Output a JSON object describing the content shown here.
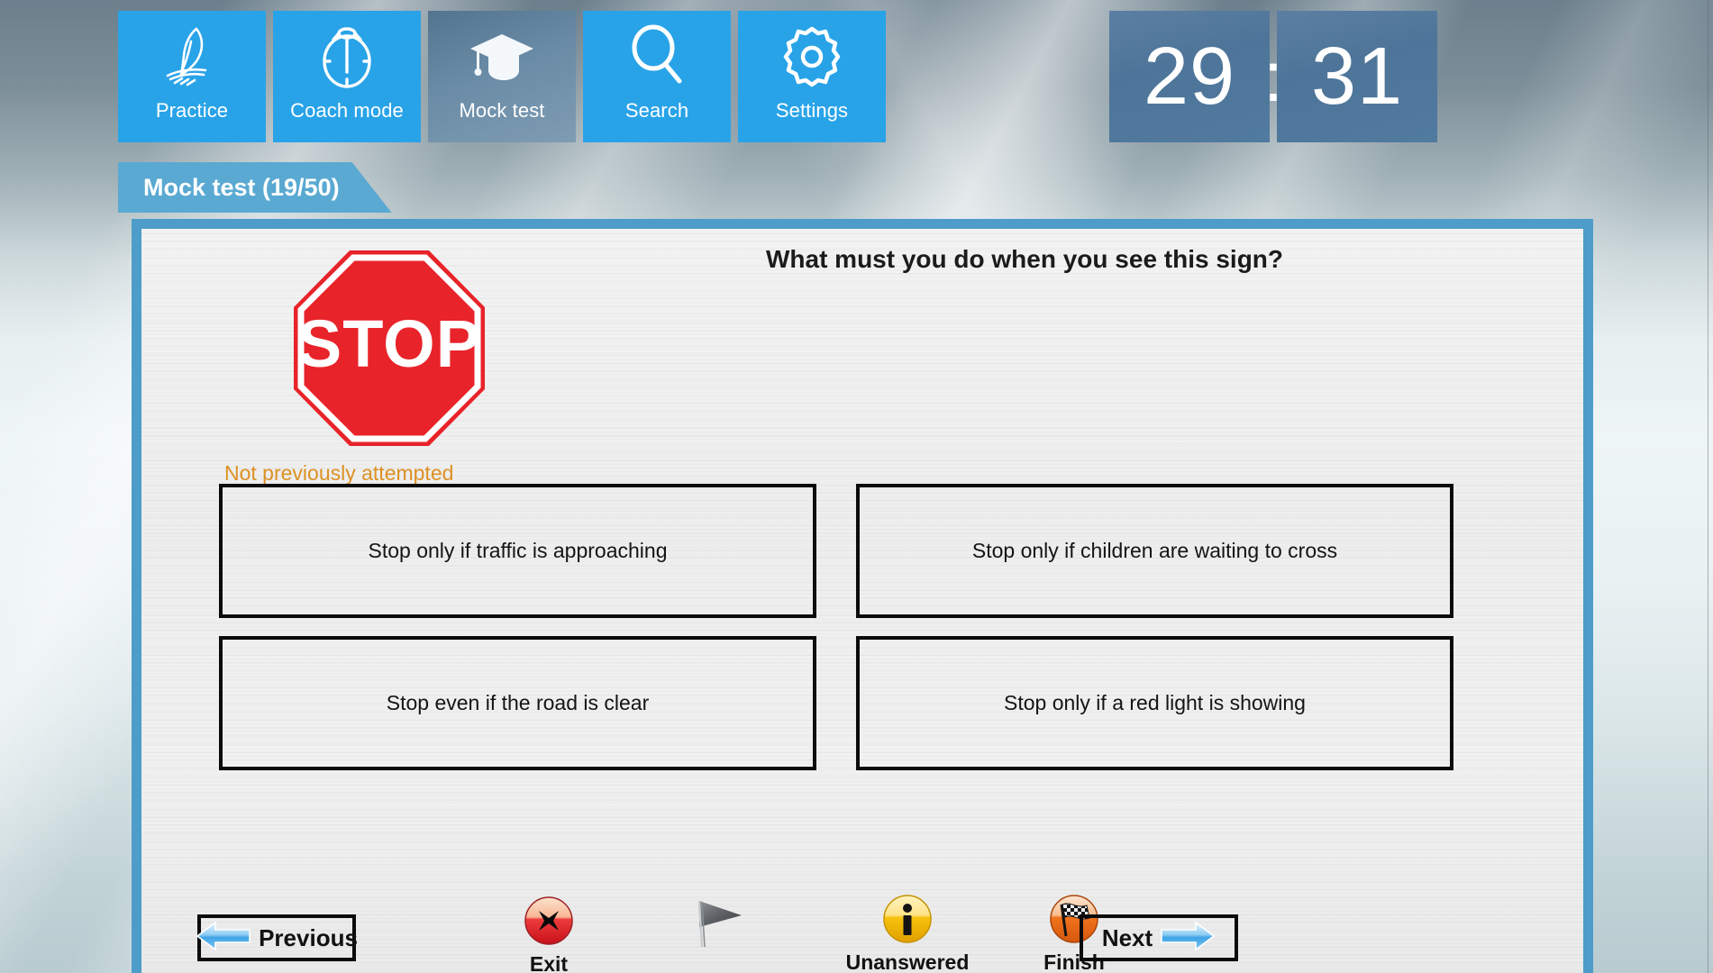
{
  "nav": {
    "tiles": [
      {
        "label": "Practice",
        "icon": "quill-pen-icon",
        "active": true
      },
      {
        "label": "Coach mode",
        "icon": "stopwatch-icon",
        "active": true
      },
      {
        "label": "Mock test",
        "icon": "graduation-cap-icon",
        "active": false
      },
      {
        "label": "Search",
        "icon": "magnifier-icon",
        "active": true
      },
      {
        "label": "Settings",
        "icon": "gear-icon",
        "active": true
      }
    ]
  },
  "timer": {
    "minutes": "29",
    "separator": ":",
    "seconds": "31"
  },
  "section": {
    "title": "Mock test (19/50)",
    "current_question": 19,
    "total_questions": 50
  },
  "question": {
    "text": "What must you do when you see this sign?",
    "sign_label": "STOP",
    "sign_type": "stop-sign",
    "attempt_status": "Not previously attempted",
    "options": [
      "Stop only if traffic is approaching",
      "Stop only if children are waiting to cross",
      "Stop even if the road is clear",
      "Stop only if a red light is showing"
    ]
  },
  "toolbar": {
    "previous_label": "Previous",
    "next_label": "Next",
    "exit_label": "Exit",
    "unanswered_label": "Unanswered",
    "finish_label": "Finish",
    "flag_label": ""
  },
  "colors": {
    "tile_blue": "#29a3e8",
    "tile_inactive": "#6a8ba6",
    "timer_blue": "#4e7599",
    "tab_blue": "#59a9d2",
    "panel_border": "#4d9cc9",
    "status_orange": "#dd9124",
    "sign_red": "#e8232a",
    "exit_red": "#e8252b",
    "info_yellow": "#f5c012",
    "finish_orange": "#ef7420"
  }
}
